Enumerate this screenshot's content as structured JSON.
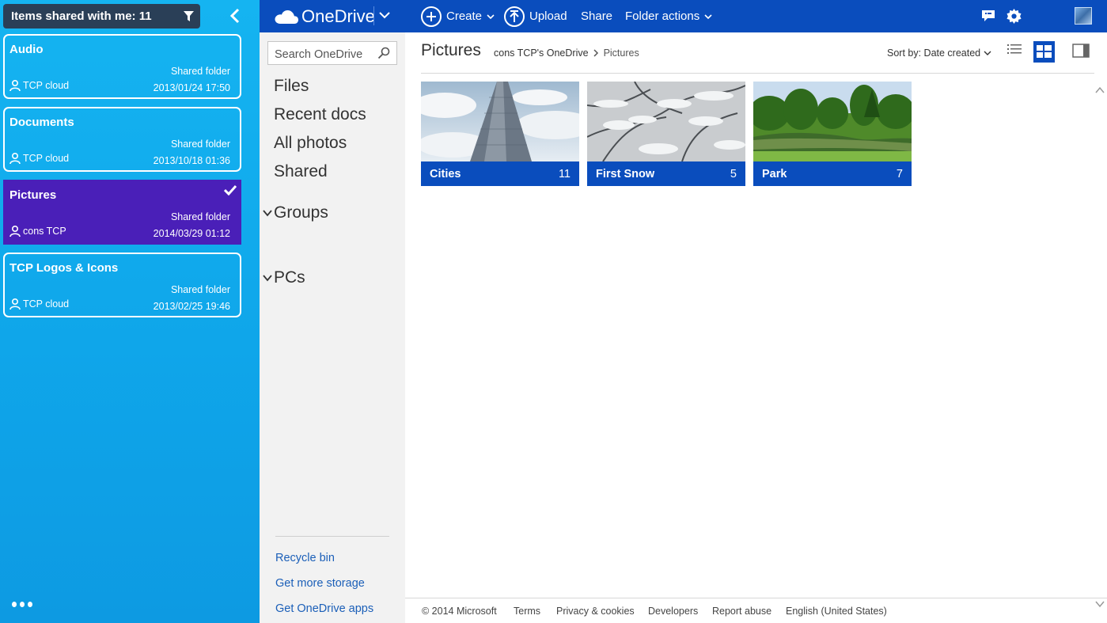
{
  "shared_pane": {
    "header": "Items shared with me: 11",
    "items": [
      {
        "title": "Audio",
        "type": "Shared folder",
        "owner": "TCP cloud",
        "date": "2013/01/24 17:50",
        "selected": false
      },
      {
        "title": "Documents",
        "type": "Shared folder",
        "owner": "TCP cloud",
        "date": "2013/10/18 01:36",
        "selected": false
      },
      {
        "title": "Pictures",
        "type": "Shared folder",
        "owner": "cons TCP",
        "date": "2014/03/29 01:12",
        "selected": true
      },
      {
        "title": "TCP Logos & Icons",
        "type": "Shared folder",
        "owner": "TCP cloud",
        "date": "2013/02/25 19:46",
        "selected": false
      }
    ]
  },
  "topbar": {
    "brand": "OneDrive",
    "create": "Create",
    "upload": "Upload",
    "share": "Share",
    "folder_actions": "Folder actions"
  },
  "nav": {
    "search_placeholder": "Search OneDrive",
    "items": [
      "Files",
      "Recent docs",
      "All photos",
      "Shared"
    ],
    "groups": "Groups",
    "pcs": "PCs",
    "links": [
      "Recycle bin",
      "Get more storage",
      "Get OneDrive apps"
    ]
  },
  "main": {
    "title": "Pictures",
    "breadcrumb": [
      "cons TCP's OneDrive",
      "Pictures"
    ],
    "sort": "Sort by: Date created",
    "tiles": [
      {
        "name": "Cities",
        "count": "11"
      },
      {
        "name": "First Snow",
        "count": "5"
      },
      {
        "name": "Park",
        "count": "7"
      }
    ]
  },
  "footer": [
    "© 2014 Microsoft",
    "Terms",
    "Privacy & cookies",
    "Developers",
    "Report abuse",
    "English (United States)"
  ],
  "colors": {
    "accent": "#0a4dbd",
    "selected_card": "#4a1fb8",
    "pane": "#15b4f1"
  }
}
